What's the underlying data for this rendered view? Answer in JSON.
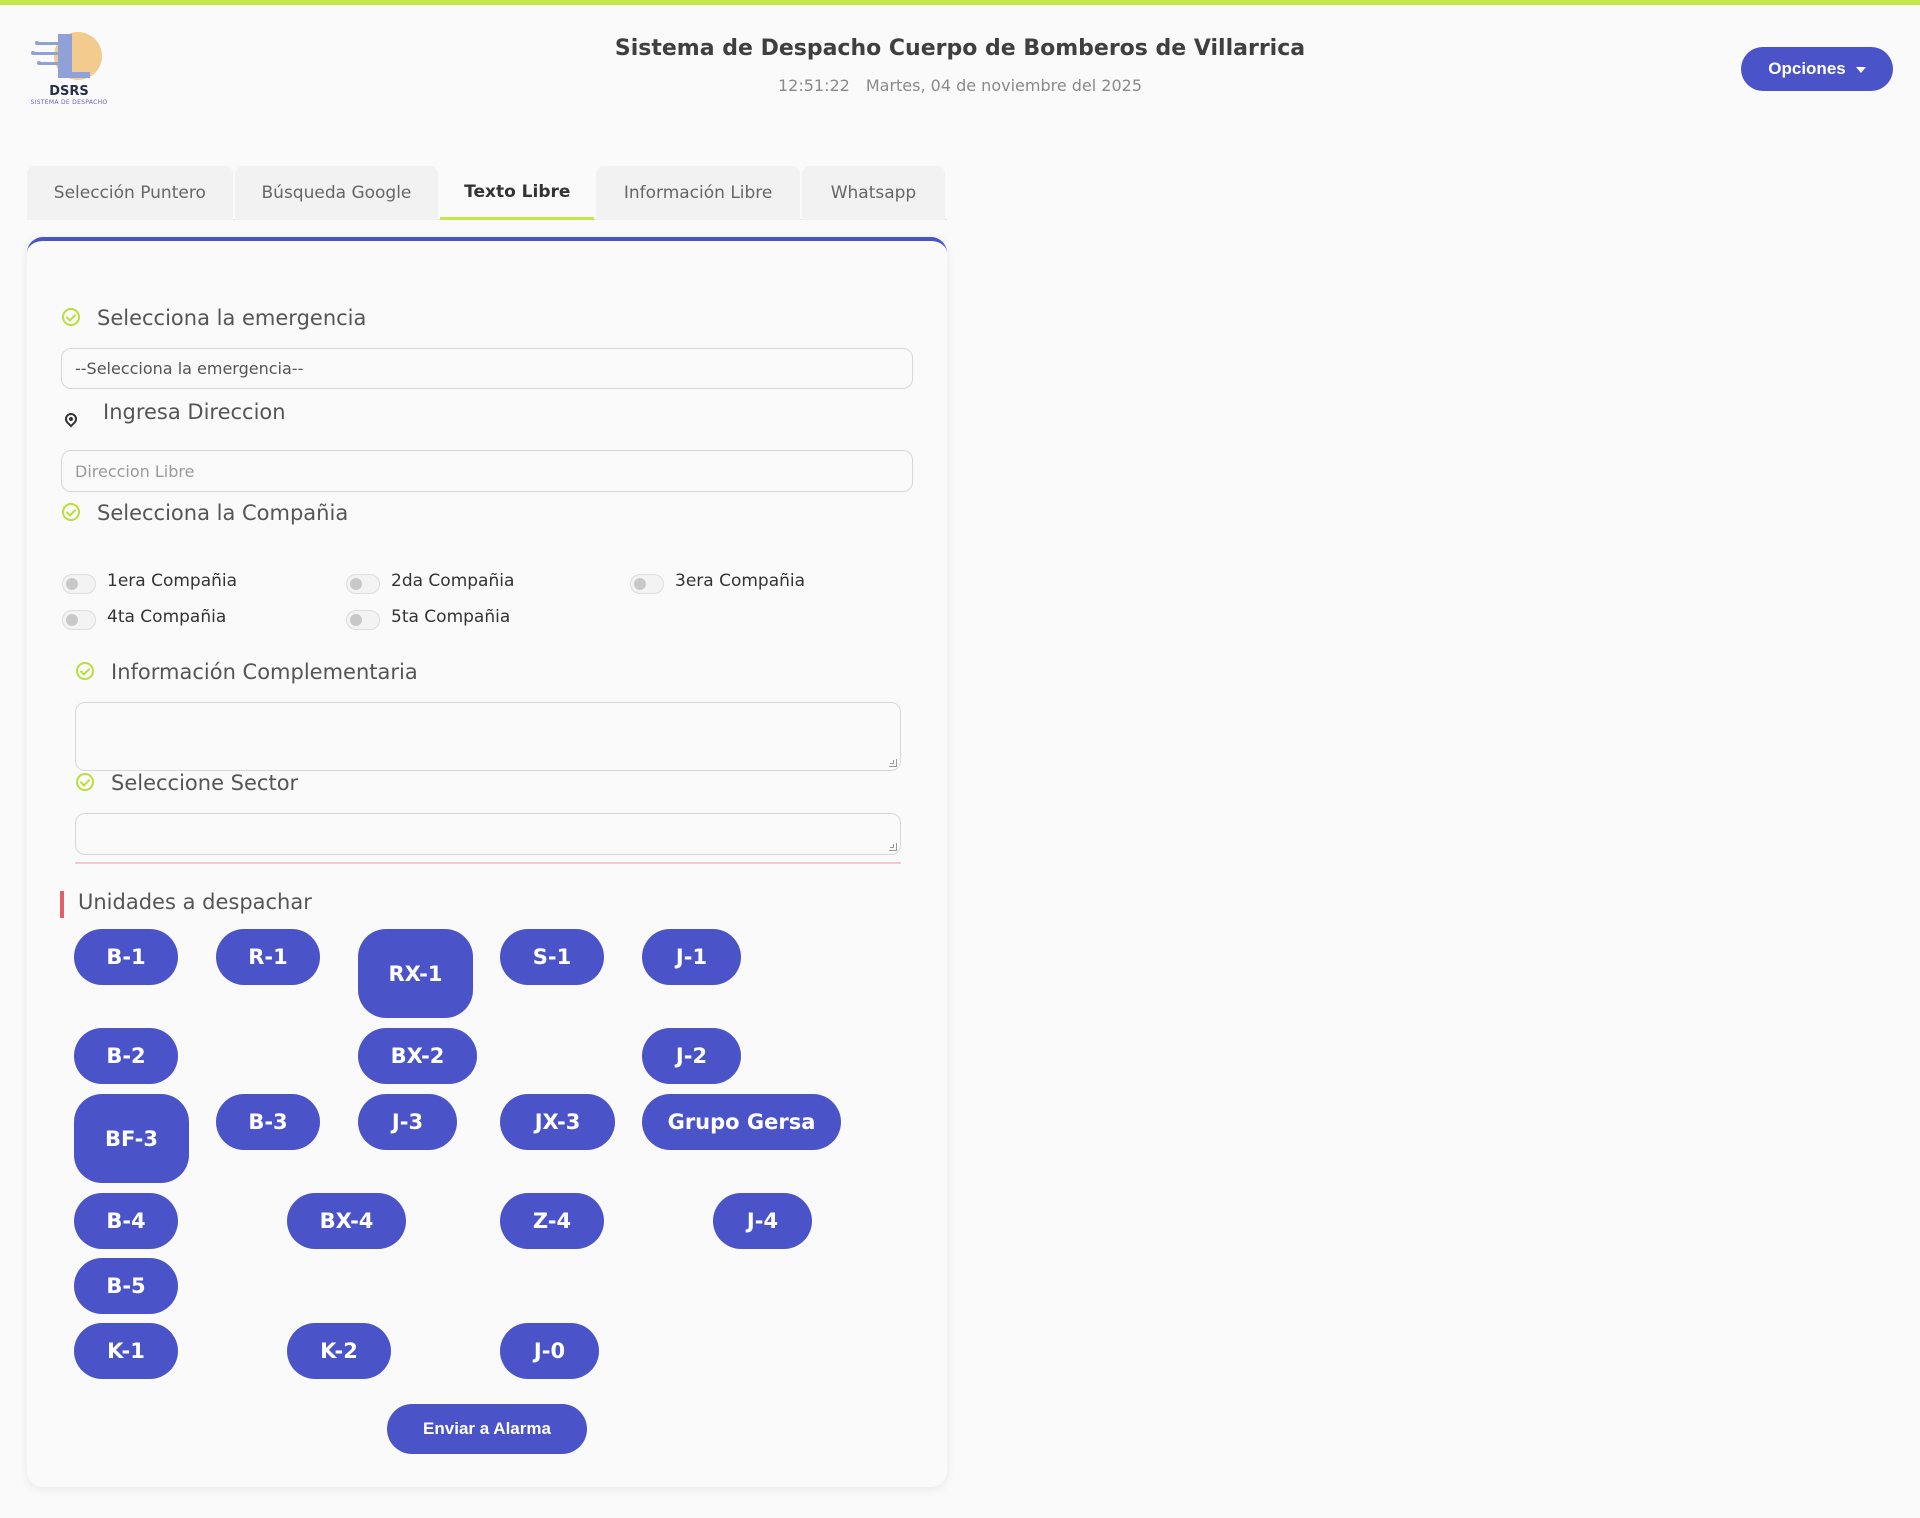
{
  "header": {
    "logo_text": "DSRS",
    "logo_subtext": "SISTEMA DE DESPACHO",
    "title": "Sistema de Despacho Cuerpo de Bomberos de Villarrica",
    "time": "12:51:22",
    "date": "Martes, 04 de noviembre del 2025",
    "options_label": "Opciones"
  },
  "tabs": [
    {
      "label": "Selección Puntero"
    },
    {
      "label": "Búsqueda Google"
    },
    {
      "label": "Texto Libre"
    },
    {
      "label": "Información Libre"
    },
    {
      "label": "Whatsapp"
    }
  ],
  "active_tab": "Texto Libre",
  "form": {
    "emergency_label": "Selecciona la emergencia",
    "emergency_value": "--Selecciona la emergencia--",
    "address_label": "Ingresa Direccion",
    "address_placeholder": "Direccion Libre",
    "company_label": "Selecciona la Compañia",
    "companies": [
      {
        "label": "1era Compañia",
        "checked": false
      },
      {
        "label": "2da Compañia",
        "checked": false
      },
      {
        "label": "3era Compañia",
        "checked": false
      },
      {
        "label": "4ta Compañia",
        "checked": false
      },
      {
        "label": "5ta Compañia",
        "checked": false
      }
    ],
    "info_label": "Información Complementaria",
    "sector_label": "Seleccione Sector"
  },
  "units_label": "Unidades a despachar",
  "units": {
    "b1": "B-1",
    "r1": "R-1",
    "rx1": "RX-1",
    "s1": "S-1",
    "j1": "J-1",
    "b2": "B-2",
    "bx2": "BX-2",
    "j2": "J-2",
    "bf3": "BF-3",
    "b3": "B-3",
    "j3": "J-3",
    "jx3": "JX-3",
    "gersa": "Grupo Gersa",
    "b4": "B-4",
    "bx4": "BX-4",
    "z4": "Z-4",
    "j4": "J-4",
    "b5": "B-5",
    "k1": "K-1",
    "k2": "K-2",
    "j0": "J-0"
  },
  "send_label": "Enviar a Alarma",
  "colors": {
    "accent": "#4a54c8",
    "highlight": "#c4e84c",
    "section_marker": "#e35d6a"
  }
}
